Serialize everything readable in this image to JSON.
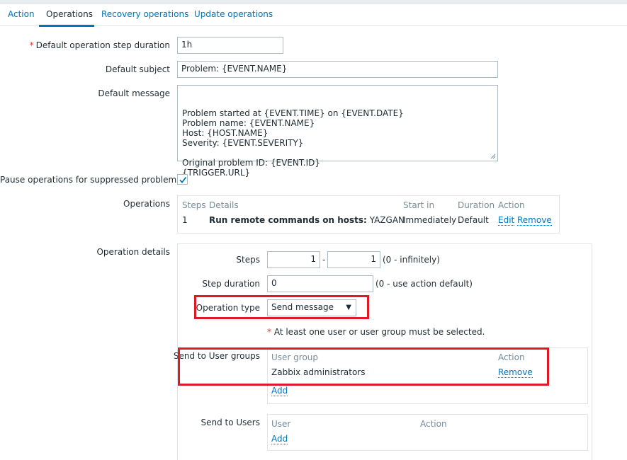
{
  "tabs": [
    {
      "label": "Action"
    },
    {
      "label": "Operations"
    },
    {
      "label": "Recovery operations"
    },
    {
      "label": "Update operations"
    }
  ],
  "form": {
    "default_step_duration": {
      "label": "Default operation step duration",
      "value": "1h"
    },
    "default_subject": {
      "label": "Default subject",
      "value": "Problem: {EVENT.NAME}"
    },
    "default_message": {
      "label": "Default message",
      "value": "Problem started at {EVENT.TIME} on {EVENT.DATE}\nProblem name: {EVENT.NAME}\nHost: {HOST.NAME}\nSeverity: {EVENT.SEVERITY}\n\nOriginal problem ID: {EVENT.ID}\n{TRIGGER.URL}"
    },
    "pause_suppressed": {
      "label": "Pause operations for suppressed problems",
      "checked": true
    }
  },
  "operations": {
    "label": "Operations",
    "headers": {
      "steps": "Steps",
      "details": "Details",
      "start_in": "Start in",
      "duration": "Duration",
      "action": "Action"
    },
    "rows": [
      {
        "steps": "1",
        "details_bold": "Run remote commands on hosts:",
        "details_rest": "YAZGAN",
        "start_in": "Immediately",
        "duration": "Default",
        "edit": "Edit",
        "remove": "Remove"
      }
    ]
  },
  "operation_details": {
    "label": "Operation details",
    "steps": {
      "label": "Steps",
      "from": "1",
      "separator": "-",
      "to": "1",
      "hint": "(0 - infinitely)"
    },
    "step_duration": {
      "label": "Step duration",
      "value": "0",
      "hint": "(0 - use action default)"
    },
    "operation_type": {
      "label": "Operation type",
      "selected": "Send message"
    },
    "required_note": "At least one user or user group must be selected.",
    "user_groups": {
      "label": "Send to User groups",
      "col_group": "User group",
      "col_action": "Action",
      "rows": [
        {
          "name": "Zabbix administrators",
          "action": "Remove"
        }
      ],
      "add": "Add"
    },
    "users": {
      "label": "Send to Users",
      "col_user": "User",
      "col_action": "Action",
      "add": "Add"
    }
  },
  "colors": {
    "accent": "#0275b8",
    "highlight": "#e11926",
    "required": "#e33734"
  }
}
